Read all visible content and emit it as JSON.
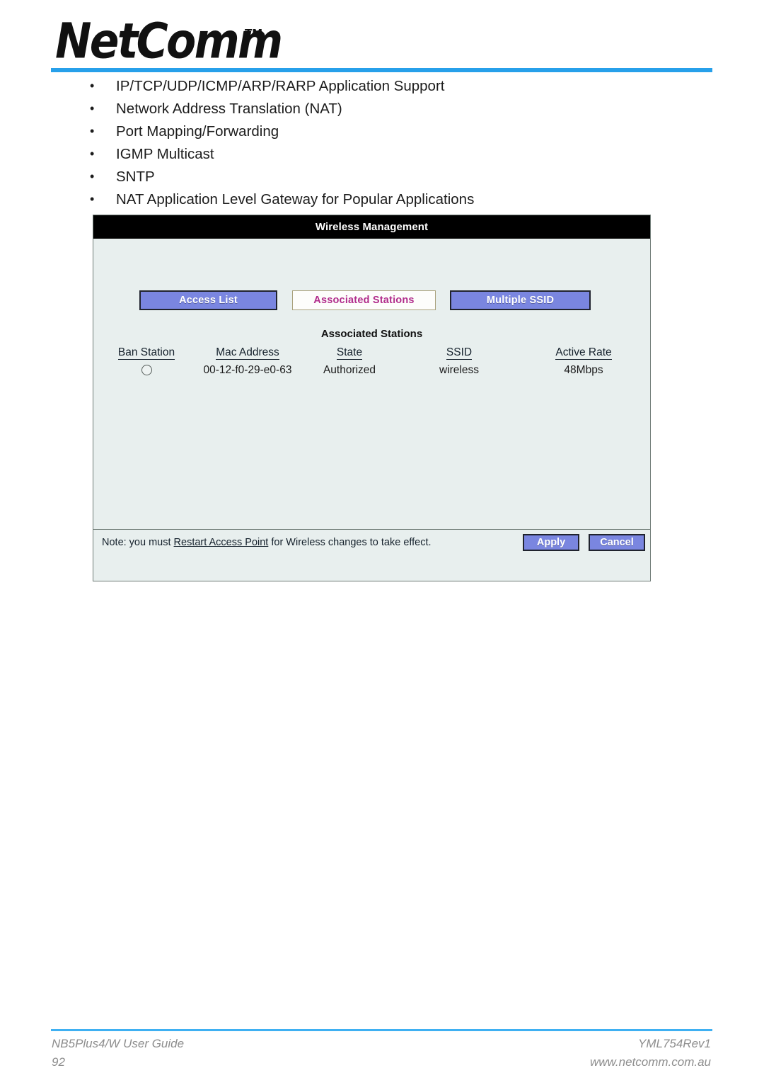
{
  "brand": {
    "wordmark": "NetComm",
    "trademark": "TM"
  },
  "features": [
    "IP/TCP/UDP/ICMP/ARP/RARP Application Support",
    "Network Address Translation (NAT)",
    "Port Mapping/Forwarding",
    "IGMP Multicast",
    "SNTP",
    "NAT Application Level Gateway for Popular Applications"
  ],
  "router_ui": {
    "title": "Wireless Management",
    "tabs": [
      {
        "label": "Access List",
        "active": false
      },
      {
        "label": "Associated Stations",
        "active": true
      },
      {
        "label": "Multiple SSID",
        "active": false
      }
    ],
    "section_title": "Associated Stations",
    "table": {
      "headers": [
        "Ban Station",
        "Mac Address",
        "State",
        "SSID",
        "Active Rate"
      ],
      "rows": [
        {
          "ban_station": "radio-unchecked",
          "mac_address": "00-12-f0-29-e0-63",
          "state": "Authorized",
          "ssid": "wireless",
          "active_rate": "48Mbps"
        }
      ]
    },
    "footer": {
      "note_prefix": "Note: you must ",
      "note_link": "Restart Access Point",
      "note_suffix": " for Wireless changes to take effect.",
      "apply_label": "Apply",
      "cancel_label": "Cancel"
    },
    "colors": {
      "titlebar": "#000000",
      "panel_bg": "#e8efee",
      "button_blue": "#7a86e0",
      "active_tab_text": "#b12d8c",
      "ssid_value": "#b3b3b3"
    }
  },
  "page_footer": {
    "guide": "NB5Plus4/W User Guide",
    "page_number": "92",
    "revision": "YML754Rev1",
    "url": "www.netcomm.com.au"
  },
  "colors": {
    "rule_top": "#27a0ea",
    "rule_footer": "#3fb0f2"
  }
}
